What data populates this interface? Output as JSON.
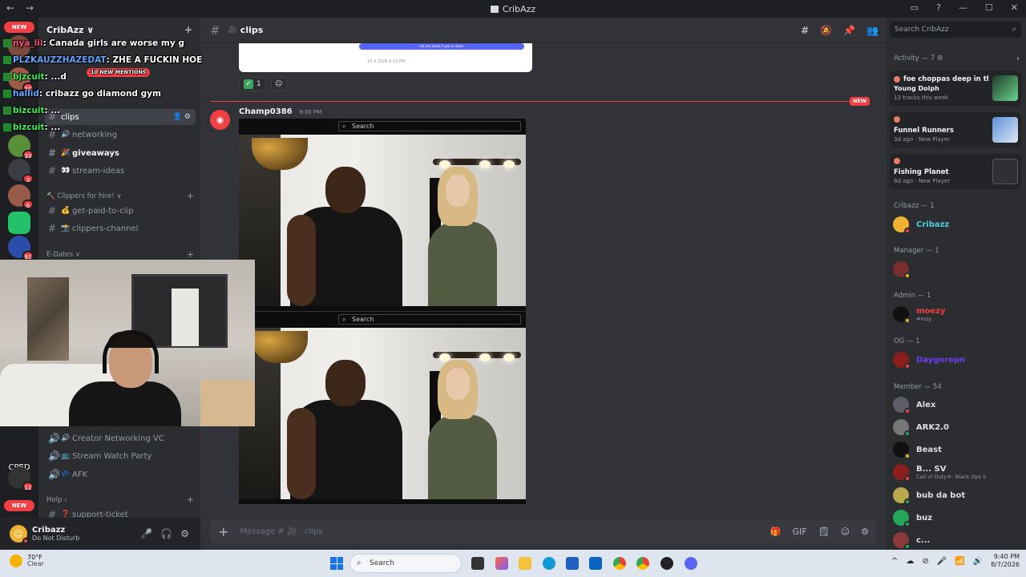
{
  "window": {
    "title": "CribAzz",
    "back": "←",
    "forward": "→",
    "controls": [
      "▭",
      "?",
      "—",
      "☐",
      "✕"
    ]
  },
  "servers": {
    "new_label": "NEW",
    "badges": [
      "94",
      "33",
      "3",
      "6",
      "81",
      "11"
    ],
    "cped_label": "CPED"
  },
  "guild": {
    "name": "CribAzz ∨",
    "add_icon": "+"
  },
  "channels": [
    {
      "name": "clips",
      "emoji": "",
      "state": "selected"
    },
    {
      "name": "networking",
      "emoji": "🔊",
      "state": "normal"
    },
    {
      "name": "giveaways",
      "emoji": "🎉",
      "state": "unread"
    },
    {
      "name": "stream-ideas",
      "emoji": "👀",
      "state": "normal"
    }
  ],
  "category_clippers": {
    "label": "🔨 Clippers for hire! ∨",
    "items": [
      {
        "name": "get-paid-to-clip",
        "emoji": "💰"
      },
      {
        "name": "clippers-channel",
        "emoji": "📸"
      }
    ]
  },
  "category_edates": {
    "label": "E-Dates ∨"
  },
  "voice_channels": [
    {
      "name": "Creator Networking VC",
      "emoji": "🔊"
    },
    {
      "name": "Stream Watch Party",
      "emoji": "📺"
    },
    {
      "name": "AFK",
      "emoji": "💤"
    }
  ],
  "category_help": {
    "label": "Help ›",
    "items": [
      {
        "name": "support-ticket",
        "emoji": "❓"
      }
    ]
  },
  "user_panel": {
    "name": "Cribazz",
    "status": "Do Not Disturb",
    "mic": "🎤",
    "headset": "🎧",
    "settings": "⚙"
  },
  "chat_overlay": [
    {
      "user": "nya_lil",
      "text": ": Canada girls are worse my g"
    },
    {
      "user": "PLZKAUZZHAZEDAT",
      "text": ": ZHE A FUCKIN HOE"
    },
    {
      "user": "bjzcuit",
      "text": ": ...d"
    },
    {
      "user": "hallid",
      "text": ": cribazz go diamond gym"
    },
    {
      "user": "bizcuit",
      "text": ": ..."
    },
    {
      "user": "bizcuit",
      "text": ": ..."
    }
  ],
  "mentions_pill": "10 NEW MENTIONS",
  "main": {
    "channel_name": "clips",
    "header_emoji": "🎥",
    "toolbar_icons": [
      "#",
      "🔕",
      "📌",
      "👥"
    ],
    "preview_bubble": "Let me know if you're down",
    "preview_meta": "10.4.2026 8:13 PM",
    "reaction": {
      "emoji": "✅",
      "count": "1"
    },
    "new_label": "NEW",
    "message": {
      "author": "Champ0386",
      "time": "9:30 PM",
      "attachments": [
        {
          "search_label": "Search"
        },
        {
          "search_label": "Search"
        }
      ]
    },
    "composer_placeholder": "Message # 🎥 · clips",
    "composer_tools": [
      "🎁",
      "GIF",
      "🗒",
      "☺",
      "⚙"
    ]
  },
  "members": {
    "search_placeholder": "Search CribAzz",
    "activity_header": "Activity — 7 ⚙",
    "activities": [
      {
        "title": "foe choppas deep in th...",
        "subtitle": "Young Dolph",
        "meta": "13 tracks this week"
      },
      {
        "title": "Funnel Runners",
        "subtitle": "",
        "meta": "3d ago · New Player"
      },
      {
        "title": "Fishing Planet",
        "subtitle": "",
        "meta": "6d ago · New Player"
      }
    ],
    "groups": [
      {
        "label": "Cribazz — 1",
        "items": [
          {
            "name": "Cribazz",
            "sub": "",
            "color": "#4dd0e1"
          }
        ]
      },
      {
        "label": "Manager — 1",
        "items": [
          {
            "name": "",
            "sub": "",
            "color": "#dbdee1"
          }
        ]
      },
      {
        "label": "Admin — 1",
        "items": [
          {
            "name": "moezy",
            "sub": "#mzy",
            "color": "#f23f43"
          }
        ]
      },
      {
        "label": "OG — 1",
        "items": [
          {
            "name": "Daygorepn",
            "sub": "",
            "color": "#6d3df2"
          }
        ]
      },
      {
        "label": "Member — 54",
        "items": [
          {
            "name": "Alex",
            "sub": "",
            "color": "#dbdee1"
          },
          {
            "name": "ARK2.0",
            "sub": "",
            "color": "#dbdee1"
          },
          {
            "name": "Beast",
            "sub": "",
            "color": "#dbdee1"
          },
          {
            "name": "B... SV",
            "sub": "Call of Duty®: Black Ops II",
            "color": "#dbdee1"
          },
          {
            "name": "bub da bot",
            "sub": "",
            "color": "#dbdee1"
          },
          {
            "name": "buz",
            "sub": "",
            "color": "#dbdee1"
          },
          {
            "name": "c...",
            "sub": "",
            "color": "#dbdee1"
          }
        ]
      }
    ]
  },
  "taskbar": {
    "temp": "70°F",
    "condition": "Clear",
    "search": "Search",
    "time": "9:40 PM",
    "date": "8/7/2026",
    "tray": [
      "^",
      "☁",
      "⊘",
      "🎤",
      "📶",
      "🔊"
    ]
  },
  "colors": {
    "accent": "#5865f2",
    "alert": "#f23f43",
    "background": "#313338",
    "sidebar": "#2b2d31"
  }
}
